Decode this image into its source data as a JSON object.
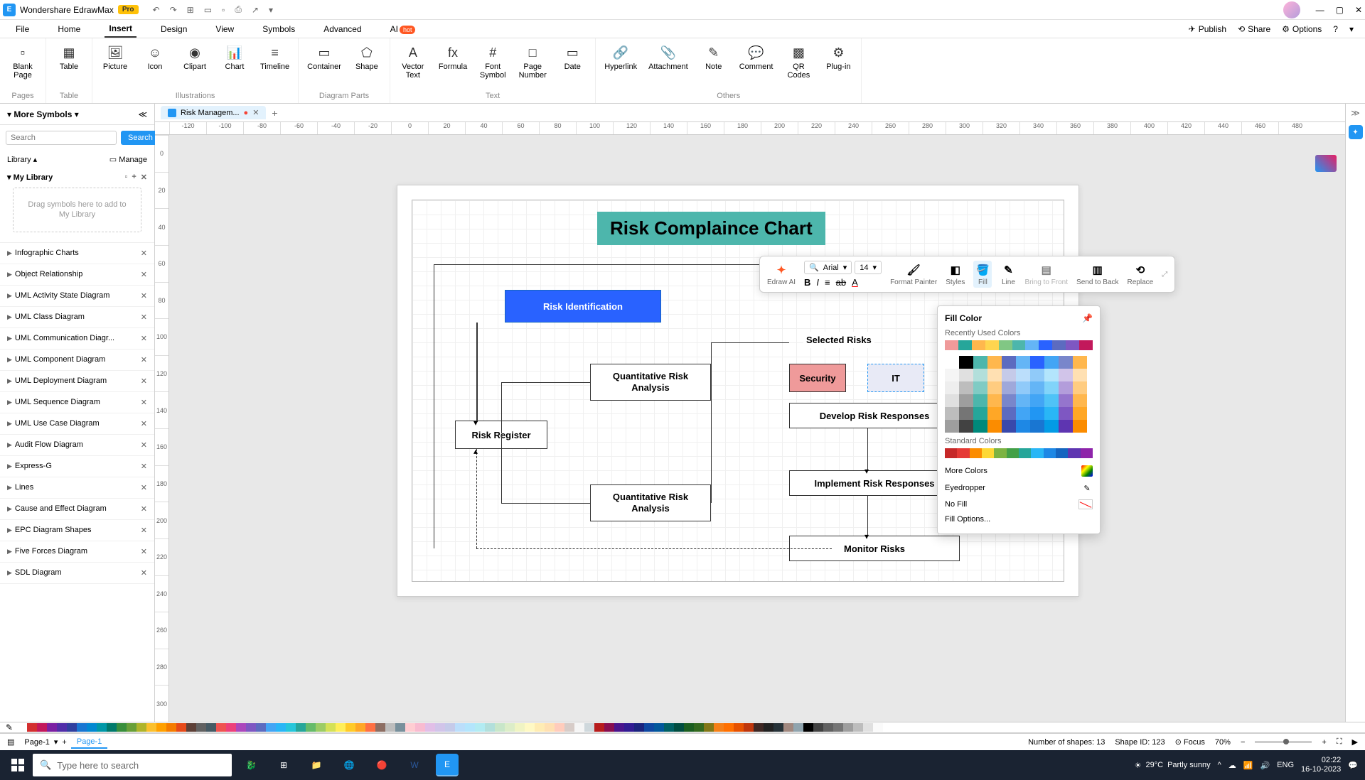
{
  "app": {
    "name": "Wondershare EdrawMax",
    "badge": "Pro"
  },
  "menu": {
    "items": [
      "File",
      "Home",
      "Insert",
      "Design",
      "View",
      "Symbols",
      "Advanced"
    ],
    "active": "Insert",
    "ai_label": "AI",
    "ai_badge": "hot",
    "right": {
      "publish": "Publish",
      "share": "Share",
      "options": "Options"
    }
  },
  "ribbon": {
    "groups": [
      {
        "label": "Pages",
        "tools": [
          {
            "label": "Blank\nPage",
            "icon": "▫"
          }
        ]
      },
      {
        "label": "Table",
        "tools": [
          {
            "label": "Table",
            "icon": "▦"
          }
        ]
      },
      {
        "label": "Illustrations",
        "tools": [
          {
            "label": "Picture",
            "icon": "🖼"
          },
          {
            "label": "Icon",
            "icon": "☺"
          },
          {
            "label": "Clipart",
            "icon": "◉"
          },
          {
            "label": "Chart",
            "icon": "📊"
          },
          {
            "label": "Timeline",
            "icon": "≡"
          }
        ]
      },
      {
        "label": "Diagram Parts",
        "tools": [
          {
            "label": "Container",
            "icon": "▭"
          },
          {
            "label": "Shape",
            "icon": "⬠"
          }
        ]
      },
      {
        "label": "Text",
        "tools": [
          {
            "label": "Vector\nText",
            "icon": "A"
          },
          {
            "label": "Formula",
            "icon": "fx"
          },
          {
            "label": "Font\nSymbol",
            "icon": "#"
          },
          {
            "label": "Page\nNumber",
            "icon": "□"
          },
          {
            "label": "Date",
            "icon": "▭"
          }
        ]
      },
      {
        "label": "Others",
        "tools": [
          {
            "label": "Hyperlink",
            "icon": "🔗"
          },
          {
            "label": "Attachment",
            "icon": "📎"
          },
          {
            "label": "Note",
            "icon": "✎"
          },
          {
            "label": "Comment",
            "icon": "💬"
          },
          {
            "label": "QR\nCodes",
            "icon": "▩"
          },
          {
            "label": "Plug-in",
            "icon": "⚙"
          }
        ]
      }
    ]
  },
  "leftPanel": {
    "title": "More Symbols",
    "searchPlaceholder": "Search",
    "searchBtn": "Search",
    "libraryLabel": "Library",
    "manageLabel": "Manage",
    "myLibrary": "My Library",
    "dropzone": "Drag symbols here to add to My Library",
    "items": [
      "Infographic Charts",
      "Object Relationship",
      "UML Activity State Diagram",
      "UML Class Diagram",
      "UML Communication Diagr...",
      "UML Component Diagram",
      "UML Deployment Diagram",
      "UML Sequence Diagram",
      "UML Use Case Diagram",
      "Audit Flow Diagram",
      "Express-G",
      "Lines",
      "Cause and Effect Diagram",
      "EPC Diagram Shapes",
      "Five Forces Diagram",
      "SDL Diagram"
    ]
  },
  "document": {
    "tabName": "Risk Managem...",
    "title": "Risk Complaince Chart",
    "shapes": {
      "riskIdentification": "Risk Identification",
      "riskRegister": "Risk Register",
      "qra1": "Quantitative Risk Analysis",
      "qra2": "Quantitative Risk Analysis",
      "selectedRisks": "Selected Risks",
      "security": "Security",
      "it": "IT",
      "developRisk": "Develop Risk Responses",
      "implementRisk": "Implement Risk Responses",
      "monitorRisks": "Monitor Risks"
    }
  },
  "rulerH": [
    "-120",
    "-100",
    "-80",
    "-60",
    "-40",
    "-20",
    "0",
    "20",
    "40",
    "60",
    "80",
    "100",
    "120",
    "140",
    "160",
    "180",
    "200",
    "220",
    "240",
    "260",
    "280",
    "300",
    "320",
    "340",
    "360",
    "380",
    "400",
    "420",
    "440",
    "460",
    "480"
  ],
  "rulerV": [
    "0",
    "20",
    "40",
    "60",
    "80",
    "100",
    "120",
    "140",
    "160",
    "180",
    "200",
    "220",
    "240",
    "260",
    "280",
    "300"
  ],
  "floatToolbar": {
    "edrawAI": "Edraw AI",
    "font": "Arial",
    "size": "14",
    "formatPainter": "Format Painter",
    "styles": "Styles",
    "fill": "Fill",
    "line": "Line",
    "bringFront": "Bring to Front",
    "sendBack": "Send to Back",
    "replace": "Replace"
  },
  "fillPopup": {
    "title": "Fill Color",
    "recentLabel": "Recently Used Colors",
    "recentColors": [
      "#EF9A9A",
      "#26A69A",
      "#FFB74D",
      "#FFD54F",
      "#81C784",
      "#4DB6AC",
      "#64B5F6",
      "#2962FF",
      "#5C6BC0",
      "#7E57C2",
      "#C2185B"
    ],
    "themeRow1": [
      "#FFFFFF",
      "#000000",
      "#4DB6AC",
      "#FFB74D",
      "#5C6BC0",
      "#64B5F6",
      "#2962FF",
      "#42A5F5",
      "#7986CB",
      "#FFB74D"
    ],
    "themeGrid": [
      [
        "#F5F5F5",
        "#E0E0E0",
        "#B2DFDB",
        "#FFE0B2",
        "#C5CAE9",
        "#BBDEFB",
        "#90CAF9",
        "#B3E5FC",
        "#D1C4E9",
        "#FFE0B2"
      ],
      [
        "#EEEEEE",
        "#BDBDBD",
        "#80CBC4",
        "#FFCC80",
        "#9FA8DA",
        "#90CAF9",
        "#64B5F6",
        "#81D4FA",
        "#B39DDB",
        "#FFCC80"
      ],
      [
        "#E0E0E0",
        "#9E9E9E",
        "#4DB6AC",
        "#FFB74D",
        "#7986CB",
        "#64B5F6",
        "#42A5F5",
        "#4FC3F7",
        "#9575CD",
        "#FFB74D"
      ],
      [
        "#BDBDBD",
        "#757575",
        "#26A69A",
        "#FFA726",
        "#5C6BC0",
        "#42A5F5",
        "#2196F3",
        "#29B6F6",
        "#7E57C2",
        "#FFA726"
      ],
      [
        "#9E9E9E",
        "#424242",
        "#00897B",
        "#FB8C00",
        "#3949AB",
        "#1E88E5",
        "#1976D2",
        "#039BE5",
        "#5E35B1",
        "#FB8C00"
      ]
    ],
    "standardLabel": "Standard Colors",
    "standardColors": [
      "#C62828",
      "#E53935",
      "#FB8C00",
      "#FDD835",
      "#7CB342",
      "#43A047",
      "#26A69A",
      "#29B6F6",
      "#1E88E5",
      "#1565C0",
      "#5E35B1",
      "#8E24AA"
    ],
    "moreColors": "More Colors",
    "eyedropper": "Eyedropper",
    "noFill": "No Fill",
    "fillOptions": "Fill Options..."
  },
  "paletteBar": [
    "#FFFFFF",
    "#D32F2F",
    "#C2185B",
    "#7B1FA2",
    "#512DA8",
    "#303F9F",
    "#1976D2",
    "#0288D1",
    "#0097A7",
    "#00796B",
    "#388E3C",
    "#689F38",
    "#AFB42B",
    "#FBC02D",
    "#FFA000",
    "#F57C00",
    "#E64A19",
    "#5D4037",
    "#616161",
    "#455A64",
    "#EF5350",
    "#EC407A",
    "#AB47BC",
    "#7E57C2",
    "#5C6BC0",
    "#42A5F5",
    "#29B6F6",
    "#26C6DA",
    "#26A69A",
    "#66BB6A",
    "#9CCC65",
    "#D4E157",
    "#FFEE58",
    "#FFCA28",
    "#FFA726",
    "#FF7043",
    "#8D6E63",
    "#BDBDBD",
    "#78909C",
    "#FFCDD2",
    "#F8BBD0",
    "#E1BEE7",
    "#D1C4E9",
    "#C5CAE9",
    "#BBDEFB",
    "#B3E5FC",
    "#B2EBF2",
    "#B2DFDB",
    "#C8E6C9",
    "#DCEDC8",
    "#F0F4C3",
    "#FFF9C4",
    "#FFECB3",
    "#FFE0B2",
    "#FFCCBC",
    "#D7CCC8",
    "#F5F5F5",
    "#CFD8DC",
    "#B71C1C",
    "#880E4F",
    "#4A148C",
    "#311B92",
    "#1A237E",
    "#0D47A1",
    "#01579B",
    "#006064",
    "#004D40",
    "#1B5E20",
    "#33691E",
    "#827717",
    "#F57F17",
    "#FF6F00",
    "#E65100",
    "#BF360C",
    "#3E2723",
    "#212121",
    "#263238",
    "#A1887F",
    "#90A4AE",
    "#000000",
    "#424242",
    "#616161",
    "#757575",
    "#9E9E9E",
    "#BDBDBD",
    "#E0E0E0",
    "#FAFAFA"
  ],
  "statusBar": {
    "pageSelector": "Page-1",
    "pageTab": "Page-1",
    "shapeCount": "Number of shapes: 13",
    "shapeId": "Shape ID: 123",
    "focus": "Focus",
    "zoom": "70%"
  },
  "taskbar": {
    "searchPlaceholder": "Type here to search",
    "weather": {
      "temp": "29°C",
      "desc": "Partly sunny"
    },
    "lang": "ENG",
    "time": "02:22",
    "date": "16-10-2023"
  }
}
